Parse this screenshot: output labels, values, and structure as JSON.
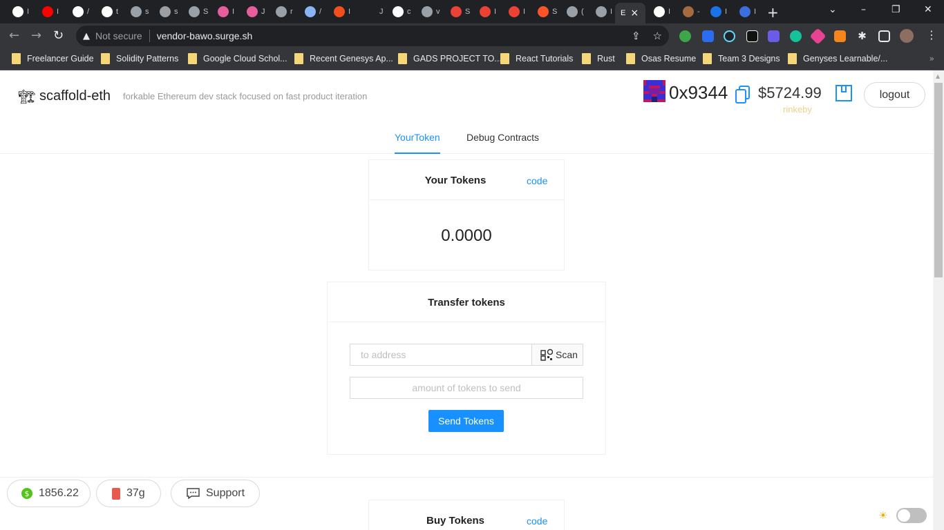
{
  "browser": {
    "tabs": [
      {
        "label": "I",
        "icon": "globe-icon",
        "color": "#ffffff"
      },
      {
        "label": "I",
        "icon": "youtube-icon",
        "color": "#ff0000"
      },
      {
        "label": "/",
        "icon": "uniswap-icon",
        "color": "#ffffff"
      },
      {
        "label": "t",
        "icon": "uniswap-icon",
        "color": "#ffffff"
      },
      {
        "label": "s",
        "icon": "github-icon",
        "color": "#9aa0a6"
      },
      {
        "label": "s",
        "icon": "github-icon",
        "color": "#9aa0a6"
      },
      {
        "label": "S",
        "icon": "github-icon",
        "color": "#9aa0a6"
      },
      {
        "label": "I",
        "icon": "gradient-icon",
        "color": "#e85d9c"
      },
      {
        "label": "J",
        "icon": "gradient-icon",
        "color": "#e85d9c"
      },
      {
        "label": "r",
        "icon": "github-icon",
        "color": "#9aa0a6"
      },
      {
        "label": "/",
        "icon": "angular-icon",
        "color": "#8ab4f8"
      },
      {
        "label": "I",
        "icon": "figma-icon",
        "color": "#f24e1e"
      },
      {
        "label": "J",
        "icon": "blank-icon",
        "color": "#202124"
      },
      {
        "label": "c",
        "icon": "openai-icon",
        "color": "#ffffff"
      },
      {
        "label": "v",
        "icon": "github-icon",
        "color": "#9aa0a6"
      },
      {
        "label": "S",
        "icon": "grid-icon",
        "color": "#ea4335"
      },
      {
        "label": "I",
        "icon": "gmail-icon",
        "color": "#ea4335"
      },
      {
        "label": "I",
        "icon": "gmail-icon",
        "color": "#ea4335"
      },
      {
        "label": "S",
        "icon": "brave-icon",
        "color": "#fb542b"
      },
      {
        "label": "(",
        "icon": "github-icon",
        "color": "#9aa0a6"
      },
      {
        "label": "I",
        "icon": "github-icon",
        "color": "#9aa0a6"
      },
      {
        "label": "E",
        "icon": "active-tab",
        "color": "#35363a"
      },
      {
        "label": "I",
        "icon": "doc-icon",
        "color": "#ffffff"
      },
      {
        "label": "-",
        "icon": "image-icon",
        "color": "#a56b3f"
      },
      {
        "label": "I",
        "icon": "loading-icon",
        "color": "#1a73e8"
      },
      {
        "label": "I",
        "icon": "link-icon",
        "color": "#3b6fe0"
      }
    ],
    "active_close": "×",
    "new_tab": "+",
    "window_controls": [
      "⌄",
      "–",
      "❐",
      "✕"
    ],
    "not_secure": "Not secure",
    "url": "vendor-bawo.surge.sh",
    "bookmarks": [
      "Freelancer Guide",
      "Solidity Patterns",
      "Google Cloud Schol...",
      "Recent Genesys Ap...",
      "GADS PROJECT TO...",
      "React Tutorials",
      "Rust",
      "Osas Resume",
      "Team 3 Designs",
      "Genyses Learnable/..."
    ],
    "bookmarks_more": "»"
  },
  "header": {
    "logo": "🏗",
    "title": "scaffold-eth",
    "subtitle": "forkable Ethereum dev stack focused on fast product iteration",
    "address": "0x9344",
    "balance": "$5724.99",
    "network": "rinkeby",
    "logout": "logout"
  },
  "menu": {
    "items": [
      "YourToken",
      "Debug Contracts"
    ],
    "active": "YourToken"
  },
  "your_tokens": {
    "title": "Your Tokens",
    "extra": "code",
    "balance": "0.0000"
  },
  "transfer": {
    "title": "Transfer tokens",
    "to_placeholder": "to address",
    "scan_label": "Scan",
    "amount_placeholder": "amount of tokens to send",
    "send_label": "Send Tokens"
  },
  "buy": {
    "title": "Buy Tokens",
    "extra": "code"
  },
  "footer": {
    "eth_price": "1856.22",
    "gas": "37g",
    "support": "Support"
  },
  "colors": {
    "accent": "#1890ff",
    "network": "#e8d28c",
    "price_icon": "#52c41a"
  }
}
